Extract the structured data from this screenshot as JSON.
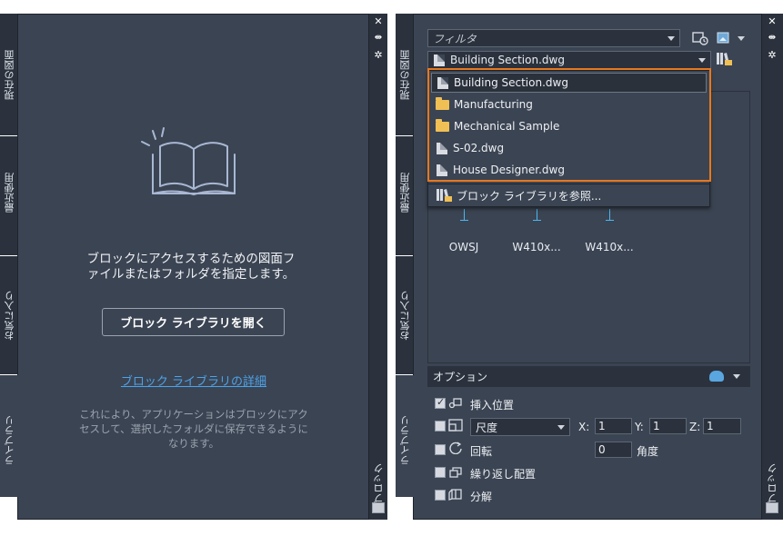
{
  "left_panel": {
    "tabs": [
      "現在の図面",
      "最近使用",
      "お気に入り",
      "ライブラリ"
    ],
    "rail_label": "ブロック",
    "message": [
      "ブロックにアクセスするための図面フ",
      "ァイルまたはフォルダを指定します。"
    ],
    "open_button": "ブロック ライブラリを開く",
    "detail_link": "ブロック ライブラリの詳細",
    "hint": [
      "これにより、アプリケーションはブロックにアク",
      "セスして、選択したフォルダに保存できるように",
      "なります。"
    ]
  },
  "right_panel": {
    "tabs": [
      "現在の図面",
      "最近使用",
      "お気に入り",
      "ライブラリ"
    ],
    "rail_label": "ブロック",
    "filter_placeholder": "フィルタ",
    "library_combo_value": "Building Section.dwg",
    "dropdown_items": [
      {
        "label": "Building Section.dwg",
        "kind": "file-icon"
      },
      {
        "label": "Manufacturing",
        "kind": "folder-icon"
      },
      {
        "label": "Mechanical Sample",
        "kind": "folder-icon"
      },
      {
        "label": "S-02.dwg",
        "kind": "file-icon"
      },
      {
        "label": "House Designer.dwg",
        "kind": "file-icon"
      }
    ],
    "browse_item": "ブロック ライブラリを参照...",
    "thumbnails": [
      "OWSJ",
      "W410x...",
      "W410x..."
    ],
    "options_title": "オプション",
    "options": {
      "insertion_point": "挿入位置",
      "scale_value": "尺度",
      "x_label": "X:",
      "x_value": "1",
      "y_label": "Y:",
      "y_value": "1",
      "z_label": "Z:",
      "z_value": "1",
      "rotation": "回転",
      "angle_value": "0",
      "angle_label": "角度",
      "repeat": "繰り返し配置",
      "explode": "分解"
    }
  },
  "colors": {
    "accent_highlight": "#e8781e",
    "link": "#4da3e8",
    "panel_bg": "#3b4453",
    "dark_bg": "#2b323d"
  }
}
